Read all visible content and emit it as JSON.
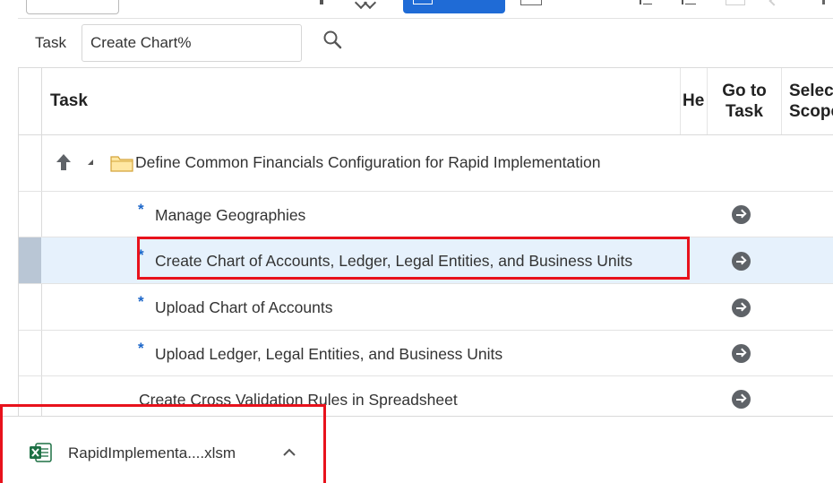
{
  "search": {
    "label": "Task",
    "value": "Create Chart%",
    "button_icon": "magnifier-icon"
  },
  "table": {
    "headers": {
      "task": "Task",
      "help": "He",
      "go_to_task_line1": "Go to",
      "go_to_task_line2": "Task",
      "select_scope_line1": "Selec",
      "select_scope_line2": "Scope"
    },
    "parent_row": {
      "label": "Define Common Financials Configuration for Rapid Implementation",
      "icons": [
        "move-up-icon",
        "collapse-triangle-icon",
        "folder-icon"
      ]
    },
    "rows": [
      {
        "label": "Manage Geographies",
        "required": true,
        "required_mark": "*",
        "selected": false
      },
      {
        "label": "Create Chart of Accounts, Ledger, Legal Entities, and Business Units",
        "required": true,
        "required_mark": "*",
        "selected": true
      },
      {
        "label": "Upload Chart of Accounts",
        "required": true,
        "required_mark": "*",
        "selected": false
      },
      {
        "label": "Upload Ledger, Legal Entities, and Business Units",
        "required": true,
        "required_mark": "*",
        "selected": false
      },
      {
        "label": "Create Cross Validation Rules in Spreadsheet",
        "required": false,
        "required_mark": "",
        "selected": false
      }
    ],
    "go_icon": "go-to-task-arrow-icon"
  },
  "download": {
    "file_name": "RapidImplementa....xlsm",
    "file_icon": "excel-file-icon",
    "menu_icon": "chevron-up-icon"
  },
  "colors": {
    "highlight": "#e8121c",
    "selected_row": "#e6f1fc",
    "primary_button": "#1f6bd6",
    "required_asterisk": "#1b66c9"
  }
}
